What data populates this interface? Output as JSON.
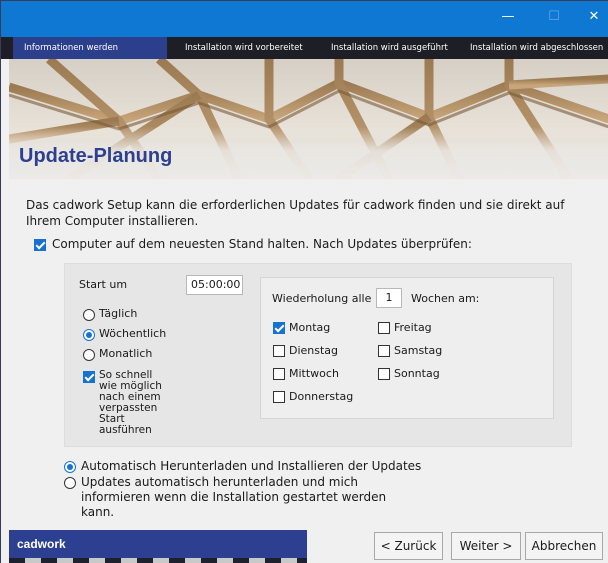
{
  "window": {
    "minimize_glyph": "—",
    "maximize_glyph": "☐",
    "close_glyph": "✕"
  },
  "steps": [
    {
      "label": "Informationen werden gesammelt",
      "active": true
    },
    {
      "label": "Installation wird vorbereitet",
      "active": false
    },
    {
      "label": "Installation wird ausgeführt",
      "active": false
    },
    {
      "label": "Installation wird abgeschlossen",
      "active": false
    }
  ],
  "page": {
    "title": "Update-Planung",
    "description": "Das cadwork Setup kann die erforderlichen Updates für cadwork finden und sie direkt auf Ihrem Computer installieren."
  },
  "keep_updated": {
    "label": "Computer auf dem neuesten Stand halten. Nach Updates überprüfen:",
    "checked": true
  },
  "schedule": {
    "start_label": "Start um",
    "start_value": "05:00:00",
    "frequency_options": [
      {
        "label": "Täglich",
        "selected": false
      },
      {
        "label": "Wöchentlich",
        "selected": true
      },
      {
        "label": "Monatlich",
        "selected": false
      }
    ],
    "asap_label": "So schnell wie möglich nach einem verpassten Start ausführen",
    "asap_checked": true,
    "repeat_label": "Wiederholung alle",
    "repeat_value": "1",
    "weeks_label": "Wochen am:",
    "days": [
      {
        "label": "Montag",
        "checked": true
      },
      {
        "label": "Dienstag",
        "checked": false
      },
      {
        "label": "Mittwoch",
        "checked": false
      },
      {
        "label": "Donnerstag",
        "checked": false
      },
      {
        "label": "Freitag",
        "checked": false
      },
      {
        "label": "Samstag",
        "checked": false
      },
      {
        "label": "Sonntag",
        "checked": false
      }
    ]
  },
  "install_mode": {
    "options": [
      {
        "label": "Automatisch Herunterladen und Installieren der Updates",
        "selected": true
      },
      {
        "label": "Updates automatisch herunterladen und mich informieren wenn die Installation gestartet werden kann.",
        "selected": false
      }
    ]
  },
  "footer": {
    "brand": "cadwork",
    "back_label": "< Zurück",
    "next_label": "Weiter >",
    "cancel_label": "Abbrechen"
  },
  "colors": {
    "titlebar": "#0f78d2",
    "brand": "#2d3f90",
    "accent": "#1672d0"
  }
}
